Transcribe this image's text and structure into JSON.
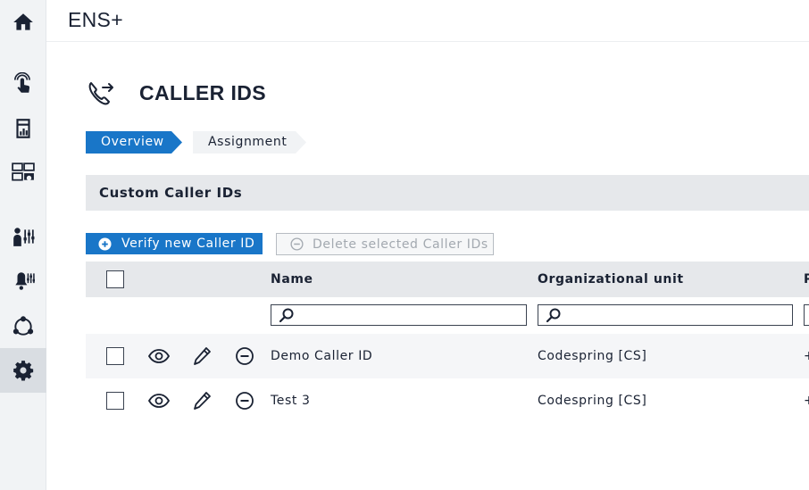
{
  "app": {
    "title": "ENS+"
  },
  "sidebar": {
    "items": [
      {
        "icon": "home-icon"
      },
      {
        "icon": "touch-alarm-icon"
      },
      {
        "icon": "report-icon"
      },
      {
        "icon": "dashboard-icon"
      },
      {
        "icon": "person-settings-icon"
      },
      {
        "icon": "bell-settings-icon"
      },
      {
        "icon": "network-icon"
      },
      {
        "icon": "gear-icon",
        "active": true
      }
    ]
  },
  "page": {
    "title": "CALLER IDS",
    "icon": "phone-forward-icon"
  },
  "tabs": [
    {
      "label": "Overview",
      "active": true
    },
    {
      "label": "Assignment",
      "active": false
    }
  ],
  "section": {
    "title": "Custom Caller IDs"
  },
  "toolbar": {
    "verify_label": "Verify new Caller ID",
    "delete_label": "Delete selected Caller IDs"
  },
  "table": {
    "columns": [
      "Name",
      "Organizational unit",
      "P"
    ],
    "rows": [
      {
        "name": "Demo Caller ID",
        "unit": "Codespring [CS]",
        "extra": "+"
      },
      {
        "name": "Test 3",
        "unit": "Codespring [CS]",
        "extra": "+"
      }
    ]
  },
  "colors": {
    "accent": "#1976c8",
    "text": "#1a2233",
    "sidebar_bg": "#f1f3f5",
    "header_bg": "#e6e8eb"
  }
}
